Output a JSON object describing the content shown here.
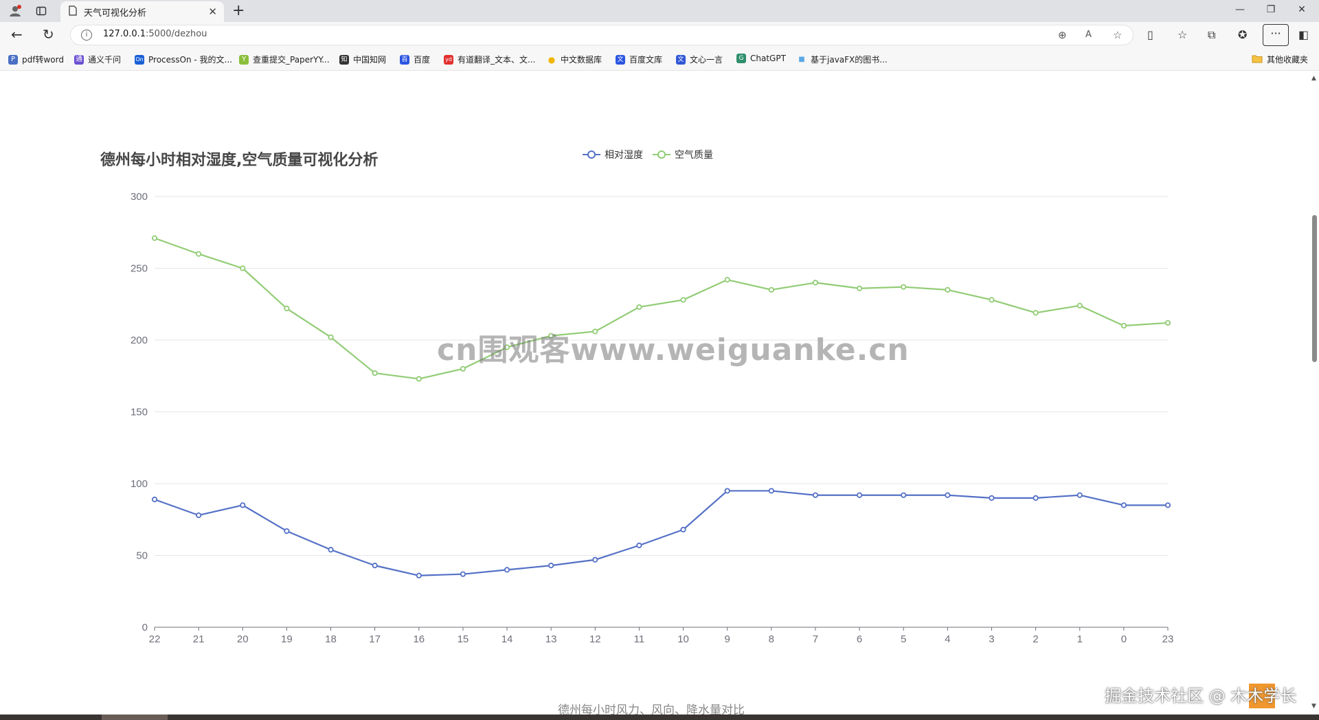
{
  "browser": {
    "tab_title": "天气可视化分析",
    "url_host": "127.0.0.1",
    "url_rest": ":5000/dezhou",
    "bookmarks": [
      {
        "label": "pdf转word",
        "color": "#4a6fc3",
        "glyph": "P"
      },
      {
        "label": "通义千问",
        "color": "#6b4fd1",
        "glyph": "通"
      },
      {
        "label": "ProcessOn - 我的文...",
        "color": "#1a5fd6",
        "glyph": "On"
      },
      {
        "label": "查重提交_PaperYY...",
        "color": "#8bbf3c",
        "glyph": "Y"
      },
      {
        "label": "中国知网",
        "color": "#333333",
        "glyph": "知"
      },
      {
        "label": "百度",
        "color": "#2b55e0",
        "glyph": "百"
      },
      {
        "label": "有道翻译_文本、文...",
        "color": "#e0312f",
        "glyph": "yd"
      },
      {
        "label": "中文数据库",
        "color": "#f2b600",
        "glyph": "●"
      },
      {
        "label": "百度文库",
        "color": "#2b55e0",
        "glyph": "文"
      },
      {
        "label": "文心一言",
        "color": "#3157d6",
        "glyph": "文"
      },
      {
        "label": "ChatGPT",
        "color": "#2f8f6c",
        "glyph": "G"
      },
      {
        "label": "基于javaFX的图书...",
        "color": "#5aa9e6",
        "glyph": "■"
      }
    ],
    "other_bookmarks": "其他收藏夹"
  },
  "page": {
    "watermark": "cn围观客www.weiguanke.cn",
    "next_chart_title": "德州每小时风力、风向、降水量对比",
    "footer_credit": "掘金技术社区 @ 木木学长"
  },
  "chart_data": {
    "type": "line",
    "title": "德州每小时相对湿度,空气质量可视化分析",
    "legend_position": "top-center",
    "categories": [
      "22",
      "21",
      "20",
      "19",
      "18",
      "17",
      "16",
      "15",
      "14",
      "13",
      "12",
      "11",
      "10",
      "9",
      "8",
      "7",
      "6",
      "5",
      "4",
      "3",
      "2",
      "1",
      "0",
      "23"
    ],
    "ylim": [
      0,
      300
    ],
    "yticks": [
      0,
      50,
      100,
      150,
      200,
      250,
      300
    ],
    "grid": true,
    "series": [
      {
        "name": "相对湿度",
        "color": "#5470c6",
        "values": [
          89,
          78,
          85,
          67,
          54,
          43,
          36,
          37,
          40,
          43,
          47,
          57,
          68,
          95,
          95,
          92,
          92,
          92,
          92,
          90,
          90,
          92,
          85,
          85
        ]
      },
      {
        "name": "空气质量",
        "color": "#91cc75",
        "values": [
          271,
          260,
          250,
          222,
          202,
          177,
          173,
          180,
          195,
          203,
          206,
          223,
          228,
          242,
          235,
          240,
          236,
          237,
          235,
          228,
          219,
          224,
          210,
          212
        ]
      }
    ]
  }
}
